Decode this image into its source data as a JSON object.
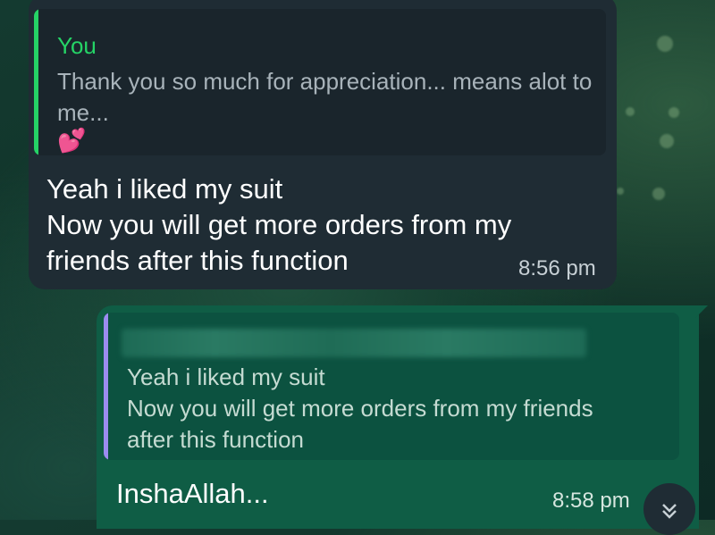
{
  "incoming": {
    "quote": {
      "author": "You",
      "text": "Thank you so much for appreciation... means alot to me...",
      "emoji": "💕"
    },
    "message_line1": "Yeah i liked my suit",
    "message_line2": "Now you will get more orders from my",
    "message_line3": "friends after this function",
    "time": "8:56 pm"
  },
  "outgoing": {
    "quote": {
      "line1": "Yeah i liked my suit",
      "line2": "Now you will get more orders from my friends",
      "line3": "after this function"
    },
    "message": "InshaAllah...",
    "time": "8:58 pm"
  },
  "scroll_icon": "double-chevron-down-icon",
  "colors": {
    "incoming_bubble": "#1f2c34",
    "outgoing_bubble": "#0f5d45",
    "quote_bar_incoming": "#25d366",
    "quote_bar_outgoing": "#9b8cf0"
  }
}
